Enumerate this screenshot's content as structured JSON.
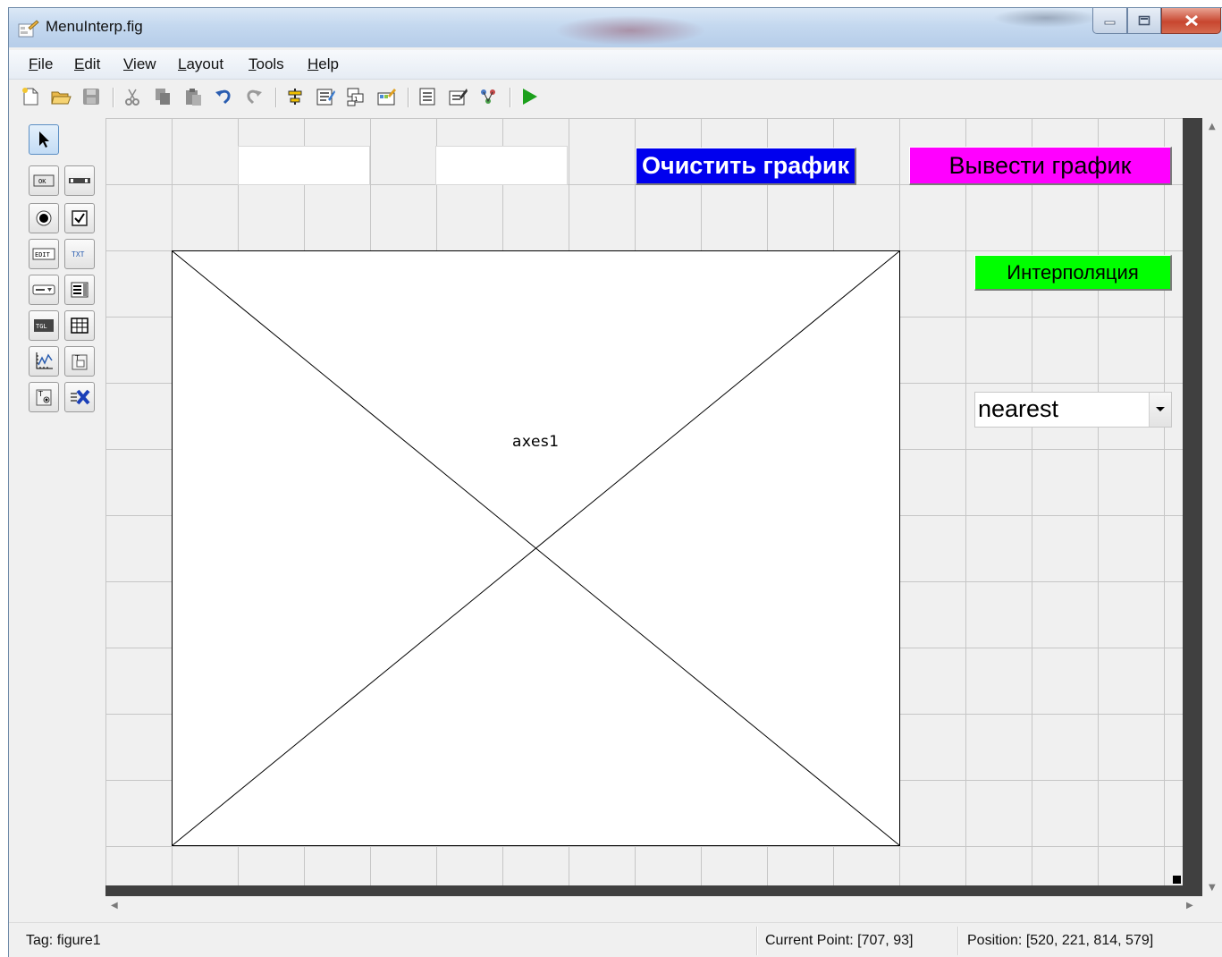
{
  "window": {
    "title": "MenuInterp.fig"
  },
  "menubar": {
    "items": [
      {
        "label": "File",
        "mnemonic": "F",
        "rest": "ile"
      },
      {
        "label": "Edit",
        "mnemonic": "E",
        "rest": "dit"
      },
      {
        "label": "View",
        "mnemonic": "V",
        "rest": "iew"
      },
      {
        "label": "Layout",
        "mnemonic": "L",
        "rest": "ayout"
      },
      {
        "label": "Tools",
        "mnemonic": "T",
        "rest": "ools"
      },
      {
        "label": "Help",
        "mnemonic": "H",
        "rest": "elp"
      }
    ]
  },
  "toolbar": {
    "icons": [
      "new-file-icon",
      "open-folder-icon",
      "save-icon",
      "cut-icon",
      "copy-icon",
      "paste-icon",
      "undo-icon",
      "redo-icon",
      "align-objects-icon",
      "menu-editor-icon",
      "tab-order-editor-icon",
      "toolbar-editor-icon",
      "editor-icon",
      "property-inspector-icon",
      "object-browser-icon",
      "run-figure-icon"
    ]
  },
  "palette": {
    "items": [
      "select-arrow-icon",
      "push-button-icon",
      "slider-icon",
      "radio-button-icon",
      "checkbox-icon",
      "edit-text-icon",
      "static-text-icon",
      "popup-menu-icon",
      "listbox-icon",
      "toggle-button-icon",
      "table-icon",
      "axes-icon",
      "panel-icon",
      "button-group-icon",
      "activex-control-icon"
    ],
    "labels": {
      "ok": "OK",
      "edit": "EDIT",
      "txt": "TXT",
      "tgl": "TGL"
    }
  },
  "canvas": {
    "btn_clear": "Очистить график",
    "btn_plot": "Вывести график",
    "btn_interp": "Интерполяция",
    "popup_value": "nearest",
    "axes_label": "axes1"
  },
  "status": {
    "tag": "Tag: figure1",
    "current_point": "Current Point:  [707, 93]",
    "position": "Position: [520, 221, 814, 579]"
  },
  "colors": {
    "btn_clear_bg": "#0000ee",
    "btn_plot_bg": "#ff00ff",
    "btn_interp_bg": "#00ff00",
    "run_icon": "#1ca01c"
  }
}
